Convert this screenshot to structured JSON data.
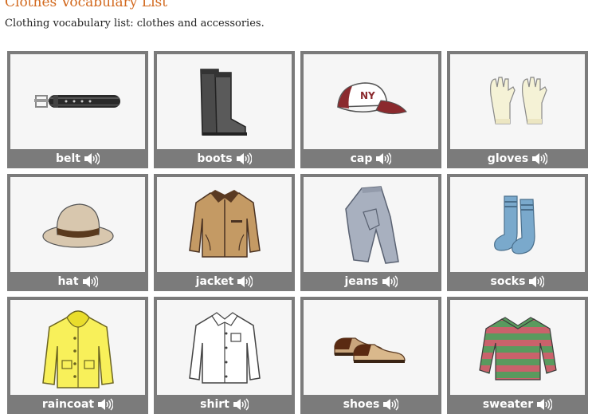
{
  "page": {
    "title": "Clothes Vocabulary List",
    "subtitle": "Clothing vocabulary list: clothes and accessories."
  },
  "items": [
    {
      "word": "belt",
      "icon": "belt-icon"
    },
    {
      "word": "boots",
      "icon": "boots-icon"
    },
    {
      "word": "cap",
      "icon": "cap-icon"
    },
    {
      "word": "gloves",
      "icon": "gloves-icon"
    },
    {
      "word": "hat",
      "icon": "hat-icon"
    },
    {
      "word": "jacket",
      "icon": "jacket-icon"
    },
    {
      "word": "jeans",
      "icon": "jeans-icon"
    },
    {
      "word": "socks",
      "icon": "socks-icon"
    },
    {
      "word": "raincoat",
      "icon": "raincoat-icon"
    },
    {
      "word": "shirt",
      "icon": "shirt-icon"
    },
    {
      "word": "shoes",
      "icon": "shoes-icon"
    },
    {
      "word": "sweater",
      "icon": "sweater-icon"
    }
  ],
  "colors": {
    "title": "#d2691e",
    "card_frame": "#7b7b7b",
    "card_bg": "#f6f6f6",
    "label_text": "#ffffff"
  }
}
